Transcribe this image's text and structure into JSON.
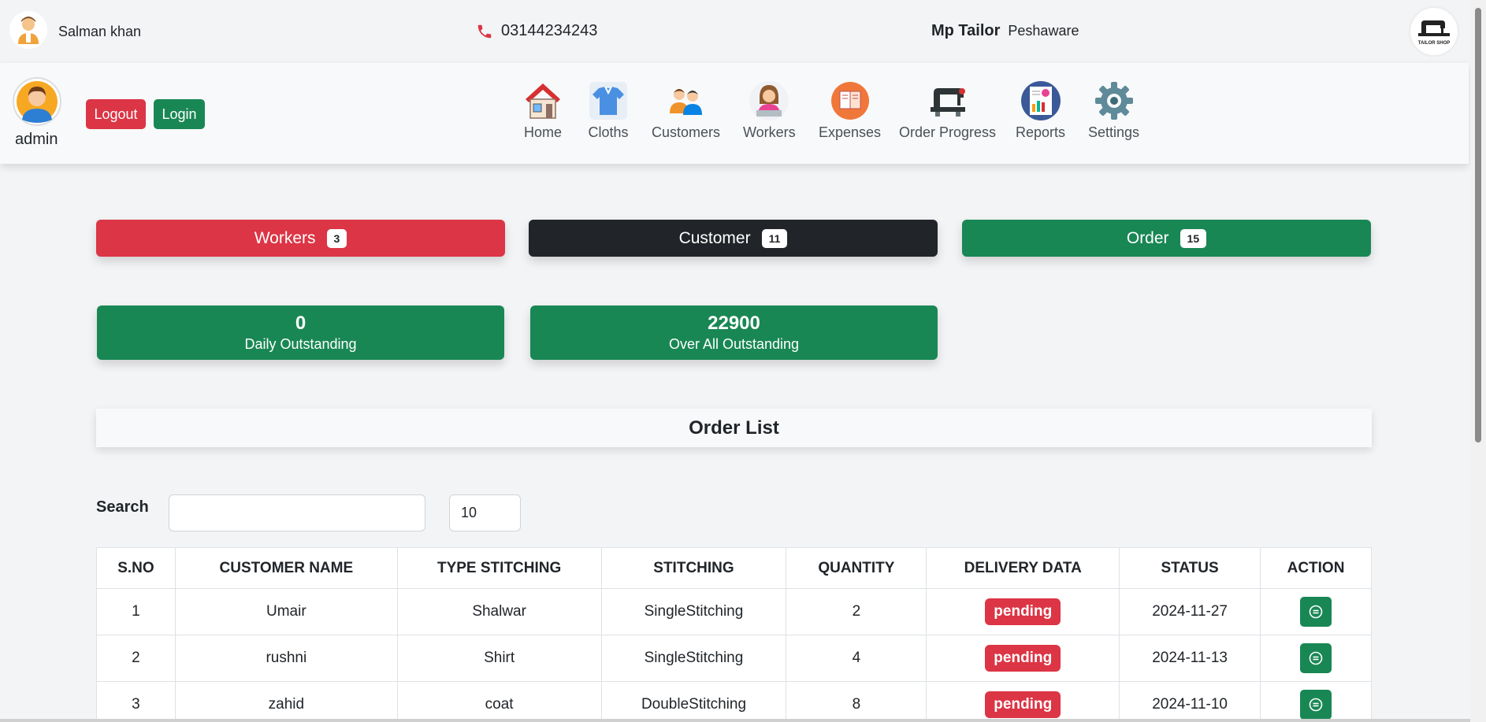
{
  "topbar": {
    "user_name": "Salman khan",
    "phone": "03144234243",
    "shop_name": "Mp Tailor",
    "shop_city": "Peshaware",
    "logo_text": "TAILOR SHOP"
  },
  "navbar": {
    "user_role": "admin",
    "logout_label": "Logout",
    "login_label": "Login",
    "items": [
      {
        "label": "Home",
        "icon": "home-icon"
      },
      {
        "label": "Cloths",
        "icon": "shirt-icon"
      },
      {
        "label": "Customers",
        "icon": "customers-icon"
      },
      {
        "label": "Workers",
        "icon": "worker-icon"
      },
      {
        "label": "Expenses",
        "icon": "expenses-icon"
      },
      {
        "label": "Order Progress",
        "icon": "sewing-machine-icon"
      },
      {
        "label": "Reports",
        "icon": "reports-icon"
      },
      {
        "label": "Settings",
        "icon": "gear-icon"
      }
    ]
  },
  "stats": {
    "workers_label": "Workers",
    "workers_count": "3",
    "customer_label": "Customer",
    "customer_count": "11",
    "order_label": "Order",
    "order_count": "15"
  },
  "outstanding": {
    "daily_value": "0",
    "daily_label": "Daily Outstanding",
    "overall_value": "22900",
    "overall_label": "Over All Outstanding"
  },
  "order_list": {
    "title": "Order List",
    "search_label": "Search",
    "search_value": "",
    "page_size": "10",
    "columns": [
      "S.NO",
      "CUSTOMER NAME",
      "TYPE STITCHING",
      "STITCHING",
      "QUANTITY",
      "DELIVERY DATA",
      "STATUS",
      "ACTION"
    ],
    "rows": [
      {
        "sno": "1",
        "customer": "Umair",
        "type": "Shalwar",
        "stitching": "SingleStitching",
        "quantity": "2",
        "delivery": "pending",
        "status": "2024-11-27"
      },
      {
        "sno": "2",
        "customer": "rushni",
        "type": "Shirt",
        "stitching": "SingleStitching",
        "quantity": "4",
        "delivery": "pending",
        "status": "2024-11-13"
      },
      {
        "sno": "3",
        "customer": "zahid",
        "type": "coat",
        "stitching": "DoubleStitching",
        "quantity": "8",
        "delivery": "pending",
        "status": "2024-11-10"
      }
    ]
  },
  "colors": {
    "red": "#dc3545",
    "dark": "#212529",
    "green": "#198754"
  }
}
